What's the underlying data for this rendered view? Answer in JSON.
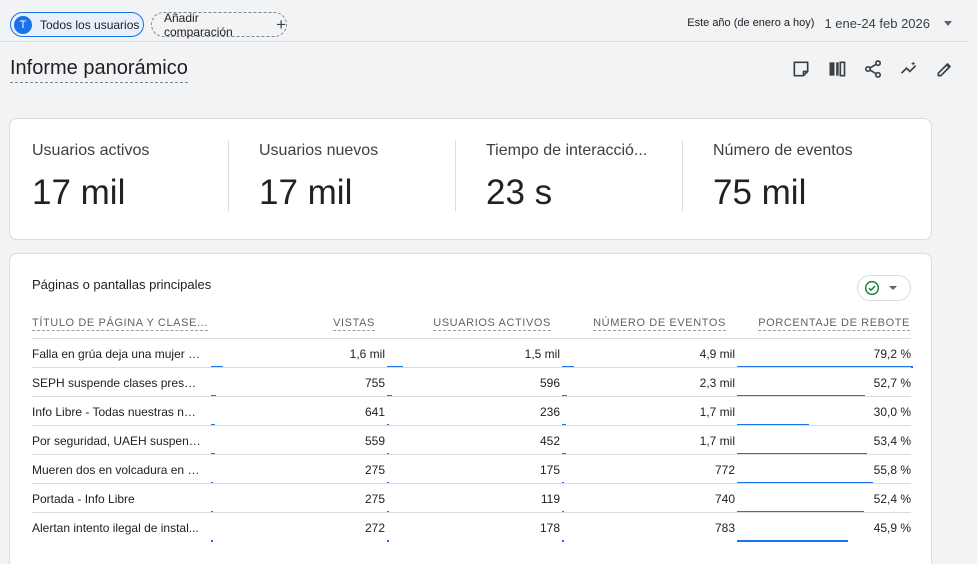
{
  "topbar": {
    "segment_avatar": "T",
    "segment_label": "Todos los usuarios",
    "compare_label": "Añadir comparación",
    "date_caption": "Este año (de enero a hoy)",
    "date_value": "1 ene-24 feb 2026"
  },
  "page_title": "Informe panorámico",
  "toolbar": {
    "icons": [
      "note-icon",
      "compare-columns-icon",
      "share-icon",
      "insights-icon",
      "edit-icon"
    ]
  },
  "kpis": [
    {
      "label": "Usuarios activos",
      "value": "17 mil"
    },
    {
      "label": "Usuarios nuevos",
      "value": "17 mil"
    },
    {
      "label": "Tiempo de interacció...",
      "value": "23 s"
    },
    {
      "label": "Número de eventos",
      "value": "75 mil"
    }
  ],
  "table": {
    "title": "Páginas o pantallas principales",
    "columns": [
      "TÍTULO DE PÁGINA Y CLASE...",
      "VISTAS",
      "USUARIOS ACTIVOS",
      "NÚMERO DE EVENTOS",
      "PORCENTAJE DE REBOTE"
    ],
    "rows": [
      {
        "title": "Falla en grúa deja una mujer si...",
        "views": "1,6 mil",
        "users": "1,5 mil",
        "events": "4,9 mil",
        "bounce": "79,2 %",
        "views_frac": 0.07,
        "users_frac": 0.09,
        "events_frac": 0.07,
        "bounce_frac": 1.0
      },
      {
        "title": "SEPH suspende clases presen...",
        "views": "755",
        "users": "596",
        "events": "2,3 mil",
        "bounce": "52,7 %",
        "views_frac": 0.03,
        "users_frac": 0.03,
        "events_frac": 0.03,
        "bounce_frac": 0.73
      },
      {
        "title": "Info Libre - Todas nuestras not...",
        "views": "641",
        "users": "236",
        "events": "1,7 mil",
        "bounce": "30,0 %",
        "views_frac": 0.02,
        "users_frac": 0.01,
        "events_frac": 0.02,
        "bounce_frac": 0.41
      },
      {
        "title": "Por seguridad, UAEH suspend...",
        "views": "559",
        "users": "452",
        "events": "1,7 mil",
        "bounce": "53,4 %",
        "views_frac": 0.02,
        "users_frac": 0.01,
        "events_frac": 0.02,
        "bounce_frac": 0.74
      },
      {
        "title": "Mueren dos en volcadura en la...",
        "views": "275",
        "users": "175",
        "events": "772",
        "bounce": "55,8 %",
        "views_frac": 0.01,
        "users_frac": 0.01,
        "events_frac": 0.01,
        "bounce_frac": 0.77
      },
      {
        "title": "Portada - Info Libre",
        "views": "275",
        "users": "119",
        "events": "740",
        "bounce": "52,4 %",
        "views_frac": 0.01,
        "users_frac": 0.01,
        "events_frac": 0.01,
        "bounce_frac": 0.72
      },
      {
        "title": "Alertan intento ilegal de instal...",
        "views": "272",
        "users": "178",
        "events": "783",
        "bounce": "45,9 %",
        "views_frac": 0.01,
        "users_frac": 0.01,
        "events_frac": 0.01,
        "bounce_frac": 0.63
      }
    ]
  },
  "colors": {
    "accent": "#1a73e8",
    "success": "#188038"
  }
}
